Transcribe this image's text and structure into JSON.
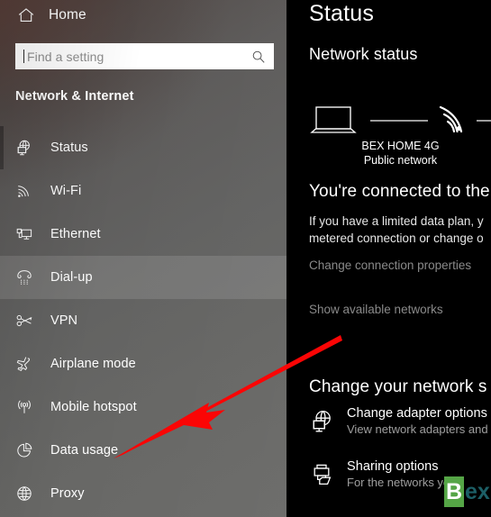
{
  "sidebar": {
    "home_label": "Home",
    "home_icon": "home-icon",
    "search": {
      "placeholder": "Find a setting",
      "value": "",
      "icon": "search-icon"
    },
    "section_title": "Network & Internet",
    "items": [
      {
        "label": "Status",
        "icon": "network-status-icon",
        "state": "selected"
      },
      {
        "label": "Wi-Fi",
        "icon": "wifi-icon",
        "state": "normal"
      },
      {
        "label": "Ethernet",
        "icon": "ethernet-icon",
        "state": "normal"
      },
      {
        "label": "Dial-up",
        "icon": "dialup-phone-icon",
        "state": "hovered"
      },
      {
        "label": "VPN",
        "icon": "vpn-key-icon",
        "state": "normal"
      },
      {
        "label": "Airplane mode",
        "icon": "airplane-icon",
        "state": "normal"
      },
      {
        "label": "Mobile hotspot",
        "icon": "hotspot-icon",
        "state": "normal"
      },
      {
        "label": "Data usage",
        "icon": "data-usage-pie-icon",
        "state": "normal"
      },
      {
        "label": "Proxy",
        "icon": "globe-icon",
        "state": "normal"
      }
    ]
  },
  "content": {
    "page_title": "Status",
    "sub_head": "Network status",
    "diagram": {
      "device_icon": "laptop-icon",
      "network_icon": "wifi-signal-icon",
      "network_name": "BEX HOME 4G",
      "network_kind": "Public network"
    },
    "status_line": "You're connected to the I",
    "status_desc_line1": "If you have a limited data plan, y",
    "status_desc_line2": "metered connection or change o",
    "link_change_properties": "Change connection properties",
    "link_show_networks": "Show available networks",
    "settings_head": "Change your network s",
    "options": [
      {
        "title": "Change adapter options",
        "sub": "View network adapters and c",
        "icon": "adapter-globe-icon"
      },
      {
        "title": "Sharing options",
        "sub": "For the networks yo",
        "icon": "sharing-printer-icon"
      }
    ]
  },
  "annotation": {
    "arrow_color": "#fb0505",
    "arrow_points_to": "Data usage"
  },
  "watermark": {
    "badge": "B",
    "text": "ex",
    "badge_color": "#55a546",
    "text_color": "#1c5f66"
  }
}
